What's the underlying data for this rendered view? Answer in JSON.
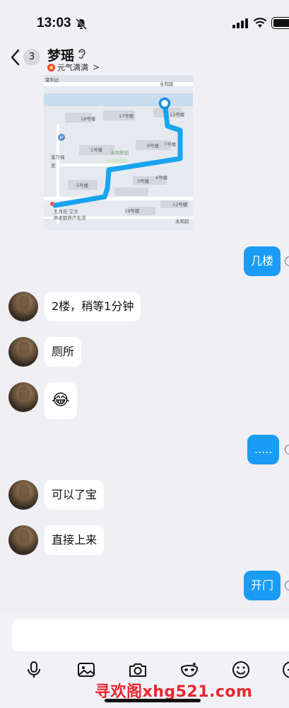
{
  "status_bar": {
    "time": "13:03"
  },
  "header": {
    "back_badge": "3",
    "contact_name": "梦瑶",
    "status_text": "元气满满"
  },
  "map": {
    "labels": [
      "永和路",
      "13号楼",
      "17号楼",
      "18号楼",
      "1号楼",
      "永和警园",
      "8号楼",
      "7号楼",
      "3号楼",
      "4号楼",
      "5号楼",
      "12号楼",
      "19号楼",
      "五月花·艾文",
      "养老颐养产生活",
      "永和前",
      "夏利达",
      "金万福",
      "亚"
    ]
  },
  "messages": [
    {
      "dir": "out",
      "text": "几楼"
    },
    {
      "dir": "in",
      "text": "2楼，稍等1分钟"
    },
    {
      "dir": "in",
      "text": "厕所"
    },
    {
      "dir": "in",
      "text": "😂"
    },
    {
      "dir": "out",
      "text": "....."
    },
    {
      "dir": "in",
      "text": "可以了宝"
    },
    {
      "dir": "in",
      "text": "直接上来"
    },
    {
      "dir": "out",
      "text": "开门"
    }
  ],
  "toolbar": {
    "icons": [
      "microphone-icon",
      "image-icon",
      "camera-icon",
      "mask-icon",
      "emoji-icon",
      "more-icon"
    ]
  },
  "watermark": "寻欢阁xhg521.com",
  "colors": {
    "outgoing_bubble": "#1a9bf4",
    "route": "#1aa3f0",
    "watermark": "#ea2630"
  }
}
